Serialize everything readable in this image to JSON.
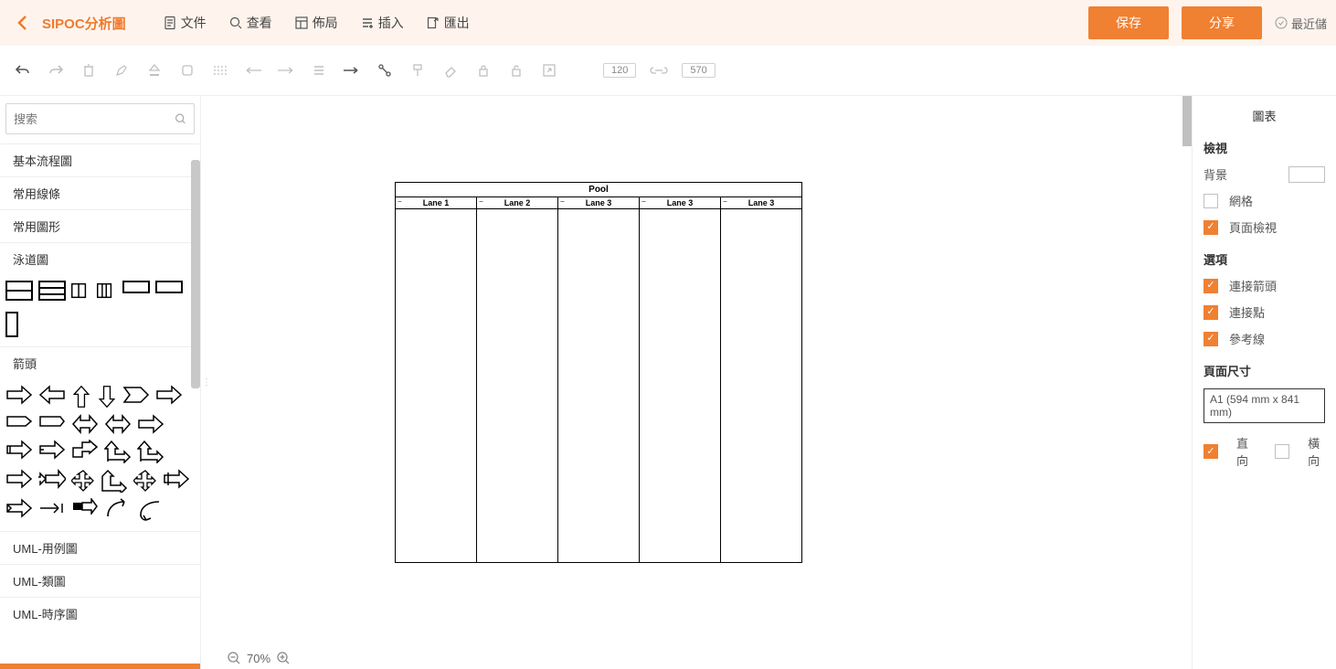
{
  "header": {
    "title": "SIPOC分析圖",
    "menus": {
      "file": "文件",
      "view": "查看",
      "layout": "佈局",
      "insert": "插入",
      "export": "匯出"
    },
    "save": "保存",
    "share": "分享",
    "recent": "最近儲"
  },
  "toolbar": {
    "w": "120",
    "h": "570"
  },
  "search": {
    "placeholder": "搜索"
  },
  "categories": {
    "basic": "基本流程圖",
    "lines": "常用線條",
    "shapes": "常用圖形",
    "swimlane": "泳道圖",
    "arrows": "箭頭",
    "uml_usecase": "UML-用例圖",
    "uml_class": "UML-類圖",
    "uml_sequence": "UML-時序圖"
  },
  "canvas": {
    "pool_title": "Pool",
    "lanes": [
      "Lane 1",
      "Lane 2",
      "Lane 3",
      "Lane 3",
      "Lane 3"
    ]
  },
  "zoom": "70%",
  "right": {
    "tab": "圖表",
    "section_view": "檢視",
    "background": "背景",
    "grid": "網格",
    "page_view": "頁面檢視",
    "section_options": "選項",
    "connect_arrows": "連接箭頭",
    "connect_points": "連接點",
    "guidelines": "參考線",
    "section_pagesize": "頁面尺寸",
    "page_size_value": "A1 (594 mm x 841 mm)",
    "portrait": "直向",
    "landscape": "橫向"
  }
}
